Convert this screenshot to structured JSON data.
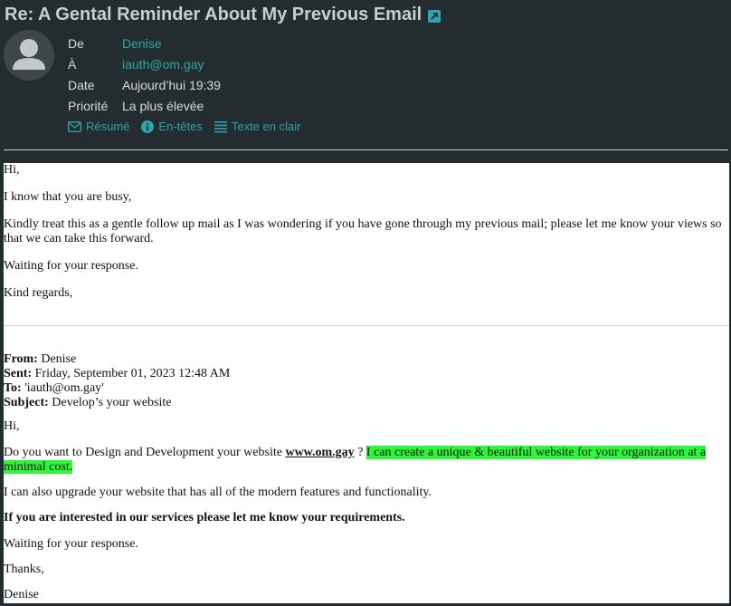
{
  "email": {
    "subject": "Re: A Gental Reminder About My Previous Email",
    "headers": {
      "from_label": "De",
      "from_value": "Denise",
      "to_label": "À",
      "to_value": "iauth@om.gay",
      "date_label": "Date",
      "date_value": "Aujourd’hui 19:39",
      "priority_label": "Priorité",
      "priority_value": "La plus élevée"
    },
    "view_toggles": {
      "summary": "Résumé",
      "headers": "En-têtes",
      "plain_text": "Texte en clair"
    }
  },
  "body": {
    "greeting": "Hi,",
    "line1": "I know that you are busy,",
    "line2": "Kindly treat this as a gentle follow up mail as I was wondering if you have gone through my previous mail; please let me know your views so that we can take this forward.",
    "line3": "Waiting for your response.",
    "signoff": "Kind regards,",
    "quoted": {
      "from_label": "From:",
      "from_value": "Denise",
      "sent_label": "Sent:",
      "sent_value": "Friday, September 01, 2023 12:48 AM",
      "to_label": "To:",
      "to_value": "'iauth@om.gay'",
      "subject_label": "Subject:",
      "subject_value": "Develop’s your website",
      "greeting": "Hi,",
      "pitch_prefix": "Do you want to Design and Development your website",
      "pitch_link": "www.om.gay",
      "pitch_mid": "?",
      "pitch_highlight": "I can create a unique & beautiful website for your organization at a minimal cost.",
      "upgrade": "I can also upgrade your website that has all of the modern features and functionality.",
      "interest": "If you are interested in our services please let me know your requirements.",
      "waiting": "Waiting for your response.",
      "thanks": "Thanks,",
      "signature": "Denise"
    }
  },
  "colors": {
    "background": "#232c2e",
    "accent": "#2fa3ad",
    "highlight": "#2ef73a"
  }
}
